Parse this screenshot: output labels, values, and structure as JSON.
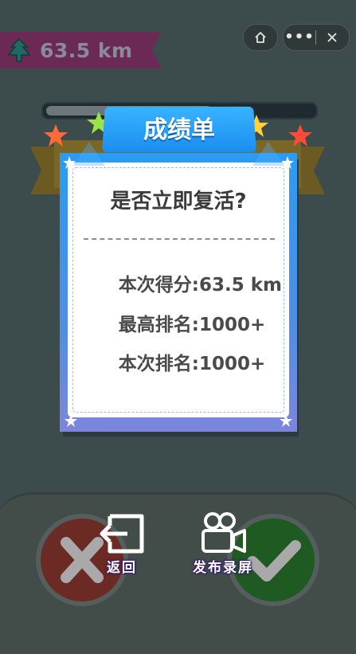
{
  "hud": {
    "distance": "63.5 km",
    "progress_fraction": 0.62
  },
  "capsule": {
    "more_label": "•••"
  },
  "result_card": {
    "title": "成绩单",
    "question": "是否立即复活?",
    "stats": [
      {
        "label": "本次得分:",
        "value": "63.5 km"
      },
      {
        "label": "最高排名:",
        "value": "1000+"
      },
      {
        "label": "本次排名:",
        "value": "1000+"
      }
    ]
  },
  "actions": {
    "back_label": "返回",
    "record_label": "发布录屏"
  },
  "colors": {
    "background": "#3c4b4b",
    "card_blue": "#2b9bf2",
    "badge": "#6a2a55",
    "confirm_green": "#1e5a22",
    "cancel_red": "#6b2a24"
  },
  "icons": {
    "hud": "tree-icon",
    "home": "home-icon",
    "close": "close-icon",
    "back": "exit-icon",
    "record": "video-camera-icon",
    "cancel": "x-icon",
    "confirm": "check-icon"
  }
}
